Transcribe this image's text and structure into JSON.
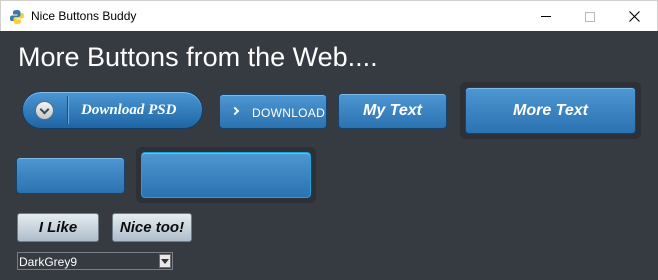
{
  "window": {
    "title": "Nice Buttons Buddy",
    "icon": "python-icon",
    "controls": [
      "minimize",
      "maximize",
      "close"
    ]
  },
  "heading": "More Buttons from the Web....",
  "buttons": {
    "download_psd": "Download PSD",
    "download": "DOWNLOAD",
    "my_text": "My Text",
    "more_text": "More Text",
    "blank_small": "",
    "blank_large": "",
    "i_like": "I Like",
    "nice_too": "Nice too!"
  },
  "theme_combo": {
    "value": "DarkGrey9"
  },
  "colors": {
    "background": "#363a41",
    "button_blue": "#3b86c4",
    "button_gray": "#c4d0da",
    "title_text": "#ffffff"
  }
}
